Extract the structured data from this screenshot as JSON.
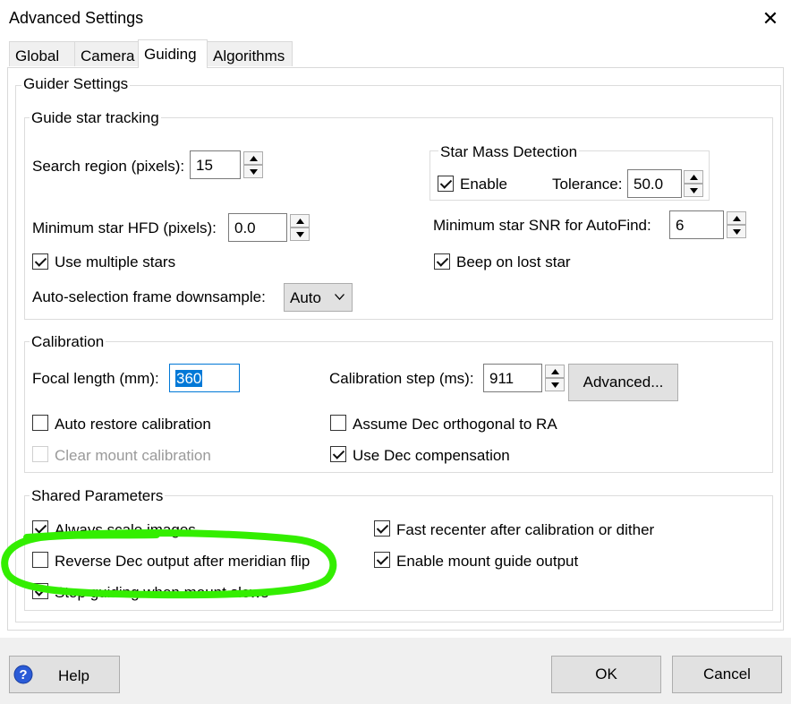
{
  "window": {
    "title": "Advanced Settings"
  },
  "tabs": [
    {
      "label": "Global"
    },
    {
      "label": "Camera"
    },
    {
      "label": "Guiding"
    },
    {
      "label": "Algorithms"
    }
  ],
  "guider_settings": {
    "title": "Guider Settings",
    "guide_star": {
      "title": "Guide star tracking",
      "search_region_label": "Search region (pixels):",
      "search_region_value": "15",
      "min_hfd_label": "Minimum star HFD (pixels):",
      "min_hfd_value": "0.0",
      "use_multiple_stars_label": "Use multiple stars",
      "auto_selection_label": "Auto-selection frame downsample:",
      "auto_selection_value": "Auto",
      "star_mass": {
        "title": "Star Mass Detection",
        "enable_label": "Enable",
        "tolerance_label": "Tolerance:",
        "tolerance_value": "50.0"
      },
      "min_snr_label": "Minimum star SNR for AutoFind:",
      "min_snr_value": "6",
      "beep_label": "Beep on lost star"
    },
    "calibration": {
      "title": "Calibration",
      "focal_length_label": "Focal length (mm):",
      "focal_length_value": "360",
      "calibration_step_label": "Calibration step (ms):",
      "calibration_step_value": "911",
      "advanced_button": "Advanced...",
      "auto_restore_label": "Auto restore calibration",
      "clear_mount_label": "Clear mount calibration",
      "assume_dec_label": "Assume Dec orthogonal to RA",
      "use_dec_comp_label": "Use Dec compensation"
    },
    "shared": {
      "title": "Shared Parameters",
      "always_scale_label": "Always scale images",
      "reverse_dec_label": "Reverse Dec output after meridian flip",
      "stop_guiding_label": "Stop guiding when mount slews",
      "fast_recenter_label": "Fast recenter after calibration or dither",
      "enable_mount_label": "Enable mount guide output"
    }
  },
  "buttons": {
    "help": "Help",
    "ok": "OK",
    "cancel": "Cancel"
  },
  "colors": {
    "accent": "#0078d7",
    "highlight_annotation": "#33ee00"
  }
}
